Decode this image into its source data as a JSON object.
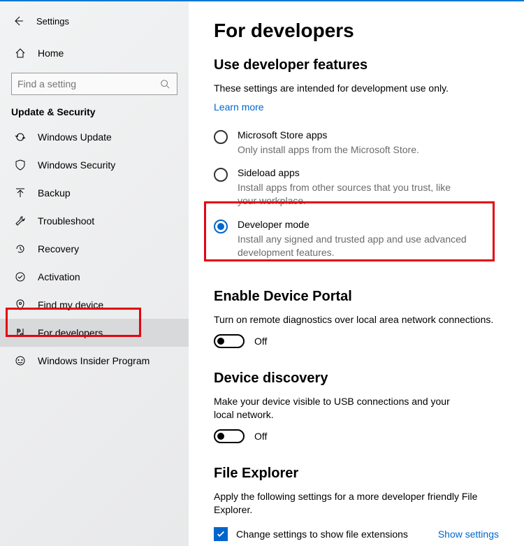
{
  "window": {
    "title": "Settings"
  },
  "sidebar": {
    "home": "Home",
    "search_placeholder": "Find a setting",
    "section": "Update & Security",
    "items": [
      {
        "label": "Windows Update"
      },
      {
        "label": "Windows Security"
      },
      {
        "label": "Backup"
      },
      {
        "label": "Troubleshoot"
      },
      {
        "label": "Recovery"
      },
      {
        "label": "Activation"
      },
      {
        "label": "Find my device"
      },
      {
        "label": "For developers"
      },
      {
        "label": "Windows Insider Program"
      }
    ]
  },
  "main": {
    "title": "For developers",
    "dev_features": {
      "heading": "Use developer features",
      "desc": "These settings are intended for development use only.",
      "learn_more": "Learn more",
      "options": [
        {
          "title": "Microsoft Store apps",
          "desc": "Only install apps from the Microsoft Store."
        },
        {
          "title": "Sideload apps",
          "desc": "Install apps from other sources that you trust, like your workplace."
        },
        {
          "title": "Developer mode",
          "desc": "Install any signed and trusted app and use advanced development features."
        }
      ]
    },
    "device_portal": {
      "heading": "Enable Device Portal",
      "desc": "Turn on remote diagnostics over local area network connections.",
      "toggle": "Off"
    },
    "device_discovery": {
      "heading": "Device discovery",
      "desc": "Make your device visible to USB connections and your local network.",
      "toggle": "Off"
    },
    "file_explorer": {
      "heading": "File Explorer",
      "desc": "Apply the following settings for a more developer friendly File Explorer.",
      "check_label": "Change settings to show file extensions",
      "show_settings": "Show settings"
    }
  }
}
